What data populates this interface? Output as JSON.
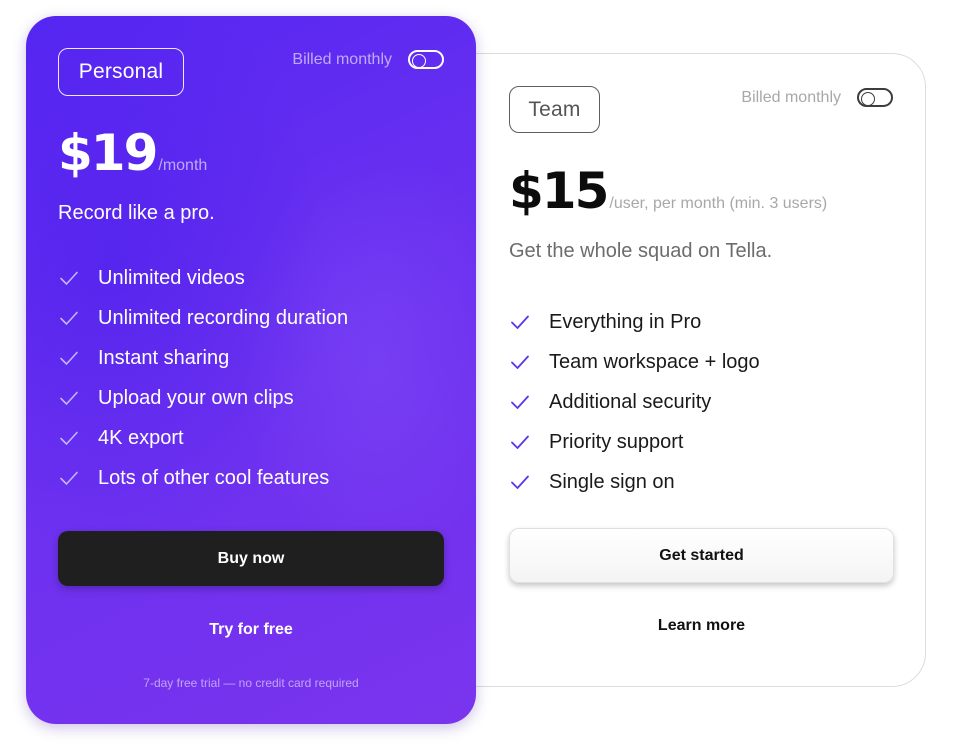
{
  "colors": {
    "personal_gradient_start": "#5626f2",
    "personal_gradient_end": "#7a34ee",
    "personal_check": "#c4b4ff",
    "team_check": "#5b35e6",
    "buy_button_bg": "#1f1f1f"
  },
  "personal": {
    "plan_name": "Personal",
    "billing_label": "Billed monthly",
    "billing_toggle_on": false,
    "price": "$19",
    "period": "/month",
    "tagline": "Record like a pro.",
    "features": [
      "Unlimited videos",
      "Unlimited recording duration",
      "Instant sharing",
      "Upload your own clips",
      "4K export",
      "Lots of other cool features"
    ],
    "cta_label": "Buy now",
    "secondary_label": "Try for free",
    "footnote": "7-day free trial — no credit card required"
  },
  "team": {
    "plan_name": "Team",
    "billing_label": "Billed monthly",
    "billing_toggle_on": false,
    "price": "$15",
    "period": "/user, per month (min. 3 users)",
    "tagline": "Get the whole squad on Tella.",
    "features": [
      "Everything in Pro",
      "Team workspace + logo",
      "Additional security",
      "Priority support",
      "Single sign on"
    ],
    "cta_label": "Get started",
    "secondary_label": "Learn more"
  },
  "icons": {
    "check": "check-icon",
    "toggle": "toggle-switch"
  }
}
